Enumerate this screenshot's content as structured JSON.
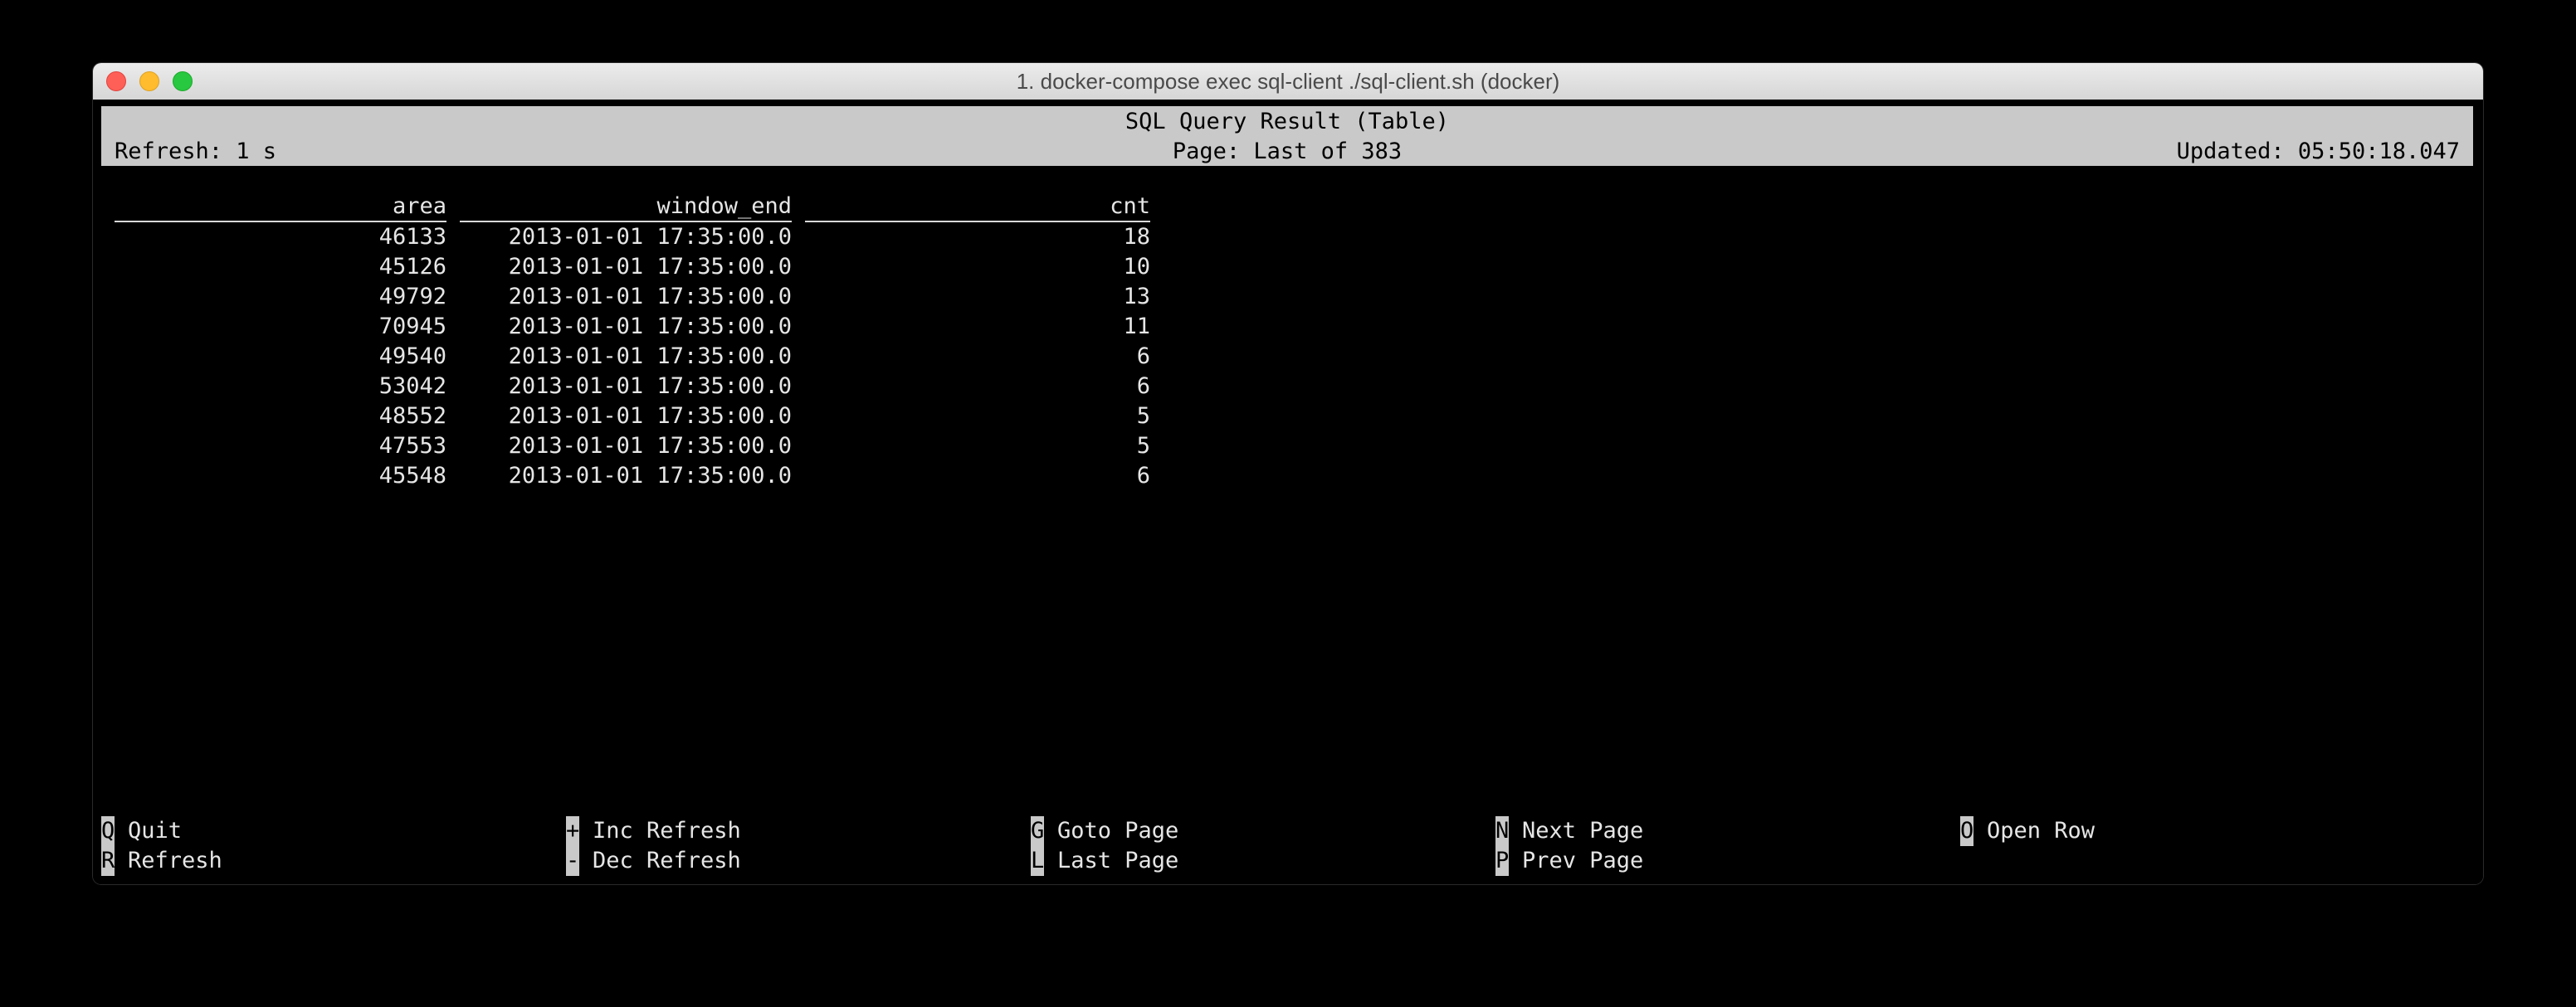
{
  "window": {
    "title": "1. docker-compose exec sql-client ./sql-client.sh (docker)"
  },
  "header": {
    "title": "SQL Query Result (Table)",
    "refresh": "Refresh: 1 s",
    "page": "Page: Last of 383",
    "updated": "Updated: 05:50:18.047"
  },
  "table": {
    "columns": [
      "area",
      "window_end",
      "cnt"
    ],
    "rows": [
      [
        "46133",
        "2013-01-01 17:35:00.0",
        "18"
      ],
      [
        "45126",
        "2013-01-01 17:35:00.0",
        "10"
      ],
      [
        "49792",
        "2013-01-01 17:35:00.0",
        "13"
      ],
      [
        "70945",
        "2013-01-01 17:35:00.0",
        "11"
      ],
      [
        "49540",
        "2013-01-01 17:35:00.0",
        "6"
      ],
      [
        "53042",
        "2013-01-01 17:35:00.0",
        "6"
      ],
      [
        "48552",
        "2013-01-01 17:35:00.0",
        "5"
      ],
      [
        "47553",
        "2013-01-01 17:35:00.0",
        "5"
      ],
      [
        "45548",
        "2013-01-01 17:35:00.0",
        "6"
      ]
    ]
  },
  "footer": {
    "keys": [
      {
        "key": "Q",
        "label": "Quit"
      },
      {
        "key": "R",
        "label": "Refresh"
      },
      {
        "key": "+",
        "label": "Inc Refresh"
      },
      {
        "key": "-",
        "label": "Dec Refresh"
      },
      {
        "key": "G",
        "label": "Goto Page"
      },
      {
        "key": "L",
        "label": "Last Page"
      },
      {
        "key": "N",
        "label": "Next Page"
      },
      {
        "key": "P",
        "label": "Prev Page"
      },
      {
        "key": "O",
        "label": "Open Row"
      }
    ]
  },
  "colors": {
    "background": "#000000",
    "text": "#e6e6e6",
    "header_bar": "#c9c9c9",
    "close": "#fe5f57",
    "minimize": "#febc2e",
    "maximize": "#28c840"
  }
}
